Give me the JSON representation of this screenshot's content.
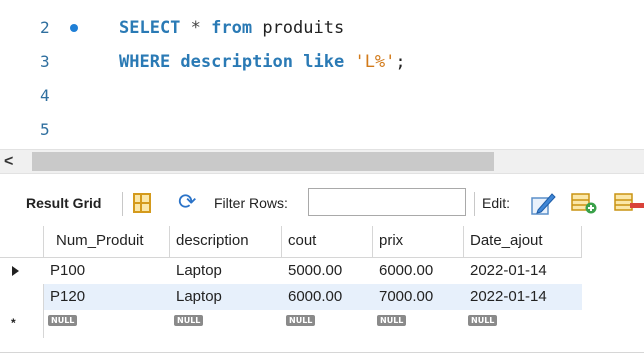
{
  "editor": {
    "lines": [
      {
        "num": "2",
        "has_marker": true,
        "kw1": "SELECT",
        "mid": " * ",
        "kw2": "from",
        "rest": " produits"
      },
      {
        "num": "3",
        "kw1": "WHERE",
        "mid": " description ",
        "kw2": "like",
        "str": "'L%'",
        "rest": ";"
      },
      {
        "num": "4"
      },
      {
        "num": "5"
      }
    ],
    "scroll_arrow": "<"
  },
  "toolbar": {
    "result_grid_label": "Result Grid",
    "filter_rows_label": "Filter Rows:",
    "filter_value": "",
    "edit_label": "Edit:"
  },
  "grid": {
    "columns": [
      "Num_Produit",
      "description",
      "cout",
      "prix",
      "Date_ajout"
    ],
    "rows": [
      [
        "P100",
        "Laptop",
        "5000.00",
        "6000.00",
        "2022-01-14"
      ],
      [
        "P120",
        "Laptop",
        "6000.00",
        "7000.00",
        "2022-01-14"
      ]
    ],
    "null_label": "NULL",
    "new_row_marker": "*"
  },
  "colors": {
    "keyword": "#2a7ab5",
    "string": "#d27a1a",
    "line_number": "#2f6f9f",
    "selected_row": "#e7f0fb"
  }
}
